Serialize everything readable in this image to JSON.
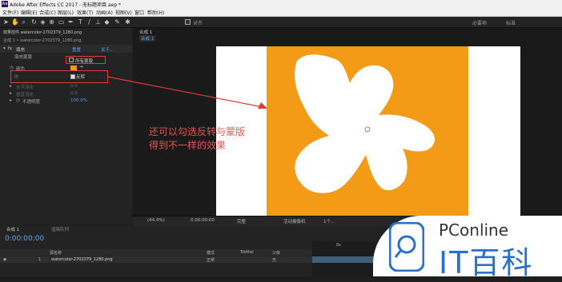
{
  "app": {
    "title": "Adobe After Effects CC 2017 - 无标题项目.aep *",
    "logo_text": "Ae",
    "menus": [
      "文件(F)",
      "编辑(E)",
      "合成(C)",
      "图层(L)",
      "效果(T)",
      "动画(A)",
      "视图(V)",
      "窗口",
      "帮助(H)"
    ]
  },
  "toolbar": {
    "tool_icons": [
      "selection-tool-icon",
      "hand-tool-icon",
      "zoom-tool-icon",
      "rotate-tool-icon",
      "camera-tool-icon",
      "pan-behind-tool-icon",
      "rectangle-tool-icon",
      "pen-tool-icon",
      "type-tool-icon",
      "brush-tool-icon",
      "clone-tool-icon",
      "eraser-tool-icon",
      "roto-tool-icon",
      "puppet-tool-icon"
    ],
    "snap_label": "对齐",
    "workspace_label": "必要项",
    "extra_label": "标准"
  },
  "effect_controls": {
    "tab_label": "效果控件 watercolor-2702379_1280.png",
    "breadcrumb": "合成 1 • watercolor-2702379_1280.png",
    "effect_name": "填充",
    "reset_label": "重置",
    "about_label": "关于...",
    "fill_mask_label": "填充蒙版",
    "all_masks_label": "所有蒙版",
    "color_label": "颜色",
    "invert_label": "反转",
    "hfeather_label": "水平羽化",
    "vfeather_label": "垂直羽化",
    "opacity_label": "不透明度",
    "opacity_value": "100.0%",
    "hfeather_value": "0.0",
    "vfeather_value": "0.0",
    "fill_color": "#f39a17"
  },
  "viewer": {
    "comp_tab": "合成 1",
    "zoom": "(44.4%)",
    "timecode": "0:00:00:00",
    "resolution": "完整",
    "camera": "活动摄像机",
    "views": "1个...",
    "canvas_bg": "#ffffff",
    "layer_color": "#f39a17"
  },
  "annotation": {
    "line1": "还可以勾选反转与蒙版",
    "line2": "得到不一样的效果",
    "color": "#e05555"
  },
  "timeline": {
    "comp_tab": "合成 1",
    "render_queue_tab": "渲染队列",
    "current_time": "0:00:00:00",
    "col_source": "源名称",
    "col_mode": "模式",
    "col_trkmat": "TrkMat",
    "col_parent": "父级",
    "layer_number": "1",
    "layer_name": "watercolor-2702379_1280.png",
    "layer_mode": "正常",
    "layer_parent": "无",
    "ruler_label": "0s"
  },
  "watermark": {
    "brand": "PConline",
    "product": "IT百科",
    "brand_color": "#2a6fc9"
  }
}
